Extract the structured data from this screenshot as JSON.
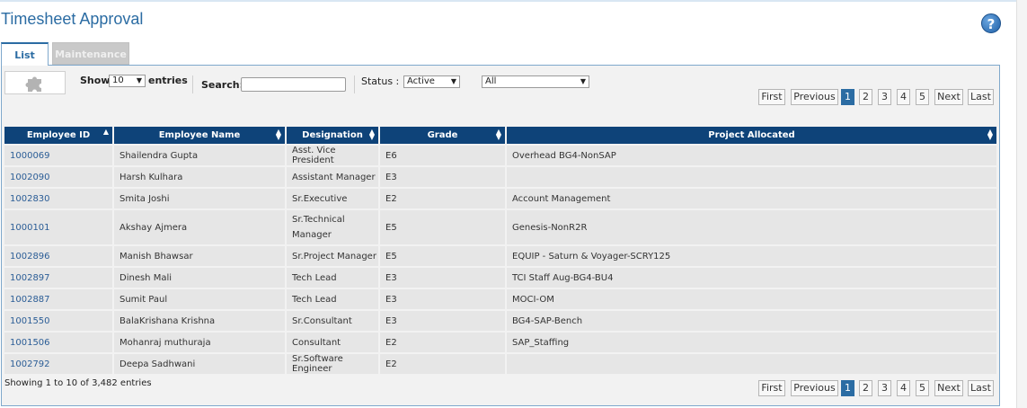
{
  "page": {
    "title": "Timesheet Approval"
  },
  "tabs": {
    "list": "List",
    "maintenance": "Maintenance"
  },
  "controls": {
    "show_label": "Show",
    "entries_value": "10",
    "entries_label": "entries",
    "search_label": "Search:",
    "search_value": "",
    "status_label": "Status :",
    "status_value": "Active",
    "filter_value": "All"
  },
  "pagination": {
    "first": "First",
    "previous": "Previous",
    "pages": [
      "1",
      "2",
      "3",
      "4",
      "5"
    ],
    "active_page": "1",
    "next": "Next",
    "last": "Last"
  },
  "table": {
    "columns": [
      "Employee ID",
      "Employee Name",
      "Designation",
      "Grade",
      "Project Allocated"
    ],
    "rows": [
      [
        "1000069",
        "Shailendra Gupta",
        "Asst. Vice President",
        "E6",
        "Overhead BG4-NonSAP"
      ],
      [
        "1002090",
        "Harsh Kulhara",
        "Assistant Manager",
        "E3",
        ""
      ],
      [
        "1002830",
        "Smita Joshi",
        "Sr.Executive",
        "E2",
        "Account Management"
      ],
      [
        "1000101",
        "Akshay Ajmera",
        "Sr.Technical Manager",
        "E5",
        "Genesis-NonR2R"
      ],
      [
        "1002896",
        "Manish Bhawsar",
        "Sr.Project Manager",
        "E5",
        "EQUIP - Saturn & Voyager-SCRY125"
      ],
      [
        "1002897",
        "Dinesh Mali",
        "Tech Lead",
        "E3",
        "TCI Staff Aug-BG4-BU4"
      ],
      [
        "1002887",
        "Sumit Paul",
        "Tech Lead",
        "E3",
        "MOCI-OM"
      ],
      [
        "1001550",
        "BalaKrishana Krishna",
        "Sr.Consultant",
        "E3",
        "BG4-SAP-Bench"
      ],
      [
        "1001506",
        "Mohanraj muthuraja",
        "Consultant",
        "E2",
        "SAP_Staffing"
      ],
      [
        "1002792",
        "Deepa Sadhwani",
        "Sr.Software Engineer",
        "E2",
        ""
      ]
    ],
    "info": "Showing 1 to 10 of 3,482 entries"
  },
  "colors": {
    "header_bg": "#0e4379",
    "accent": "#2b6ca3",
    "row_bg": "#e6e6e6"
  },
  "icons": {
    "help": "help-icon",
    "puzzle": "puzzle-icon"
  }
}
